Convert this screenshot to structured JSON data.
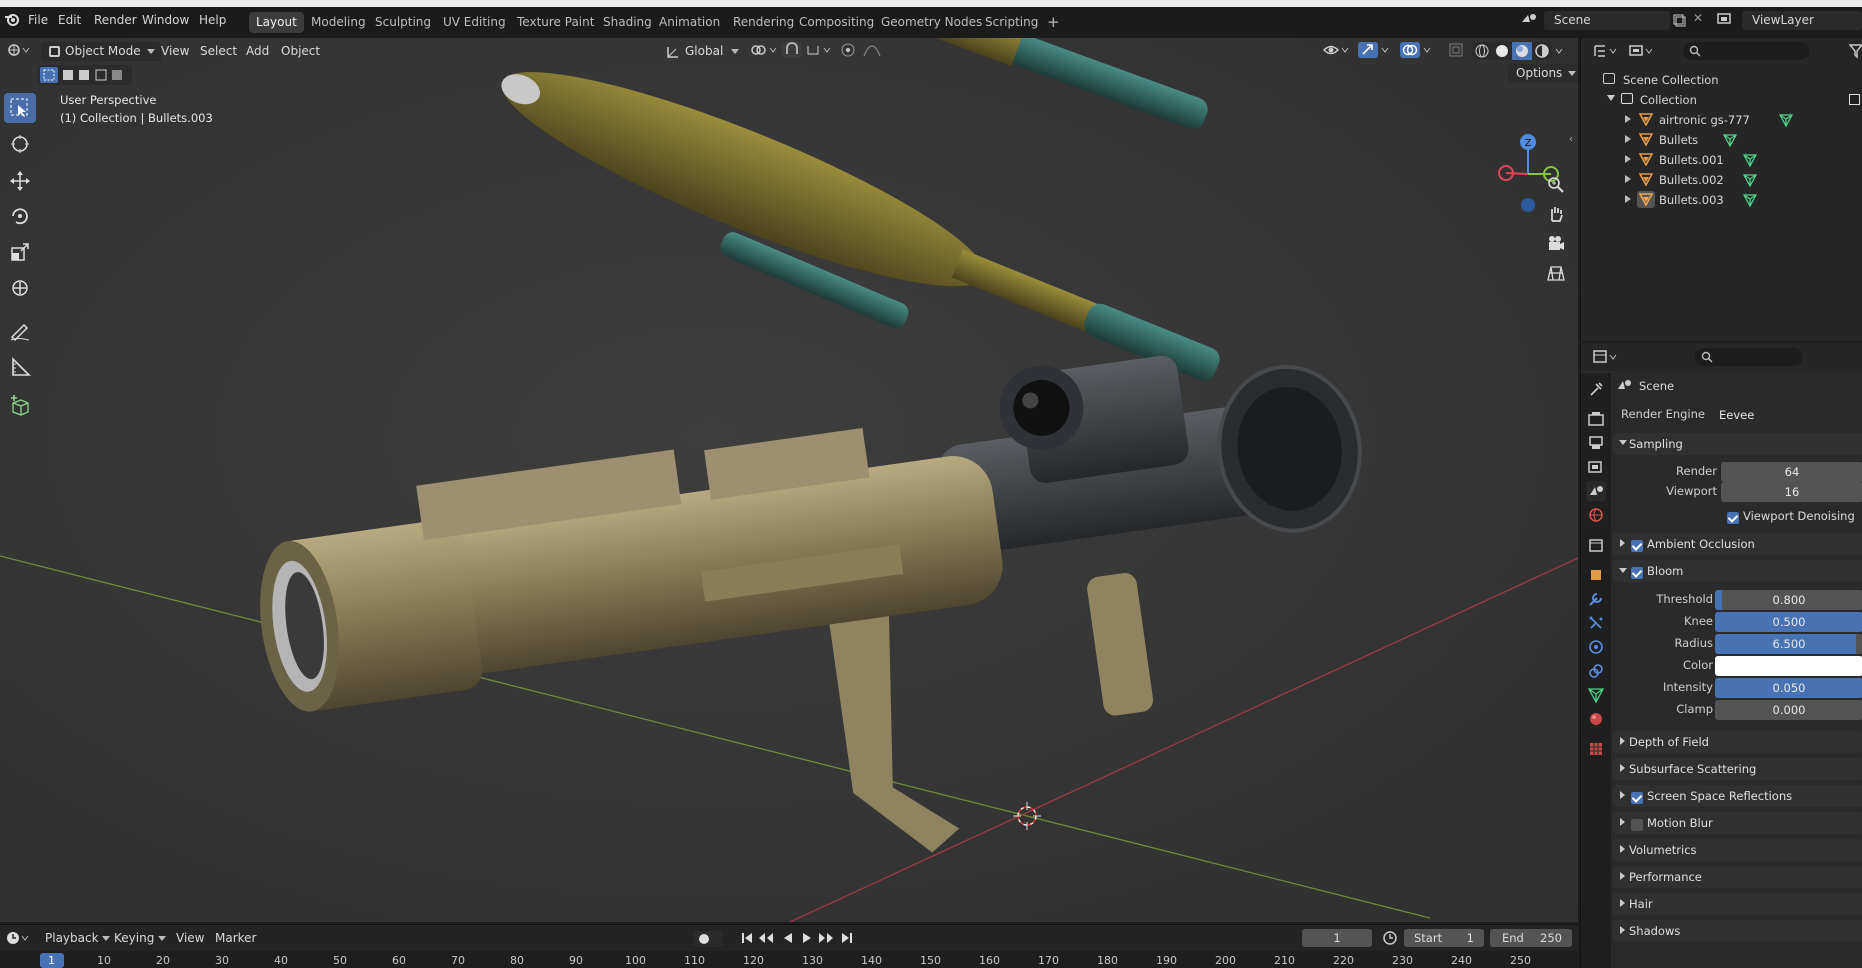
{
  "topbar": {
    "menus": [
      "File",
      "Edit",
      "Render",
      "Window",
      "Help"
    ],
    "workspaces": [
      "Layout",
      "Modeling",
      "Sculpting",
      "UV Editing",
      "Texture Paint",
      "Shading",
      "Animation",
      "Rendering",
      "Compositing",
      "Geometry Nodes",
      "Scripting"
    ],
    "active_workspace": "Layout",
    "add_workspace": "+",
    "scene_label": "Scene",
    "viewlayer_label": "ViewLayer"
  },
  "viewport_header": {
    "mode": "Object Mode",
    "menus": [
      "View",
      "Select",
      "Add",
      "Object"
    ],
    "orientation": "Global",
    "options": "Options"
  },
  "viewport": {
    "perspective": "User Perspective",
    "collection_info": "(1) Collection | Bullets.003",
    "gizmo_axes": [
      "Z",
      "X",
      "Y"
    ],
    "colors": {
      "x": "#e2455a",
      "y": "#8bc34a",
      "z": "#4f8be0",
      "accent": "#4772b3"
    }
  },
  "outliner": {
    "root": "Scene Collection",
    "collection": "Collection",
    "items": [
      "airtronic gs-777",
      "Bullets",
      "Bullets.001",
      "Bullets.002",
      "Bullets.003"
    ]
  },
  "properties": {
    "context": "Scene",
    "render_engine_label": "Render Engine",
    "render_engine": "Eevee",
    "sampling": {
      "title": "Sampling",
      "render_label": "Render",
      "render": "64",
      "viewport_label": "Viewport",
      "viewport": "16",
      "denoise": "Viewport Denoising"
    },
    "ambient_occlusion": "Ambient Occlusion",
    "bloom": {
      "title": "Bloom",
      "threshold_label": "Threshold",
      "threshold": "0.800",
      "threshold_fill": 0.05,
      "knee_label": "Knee",
      "knee": "0.500",
      "knee_fill": 1.0,
      "radius_label": "Radius",
      "radius": "6.500",
      "radius_fill": 0.95,
      "color_label": "Color",
      "intensity_label": "Intensity",
      "intensity": "0.050",
      "intensity_fill": 1.0,
      "clamp_label": "Clamp",
      "clamp": "0.000"
    },
    "panels": [
      {
        "label": "Depth of Field",
        "checkbox": null
      },
      {
        "label": "Subsurface Scattering",
        "checkbox": null
      },
      {
        "label": "Screen Space Reflections",
        "checkbox": true
      },
      {
        "label": "Motion Blur",
        "checkbox": false
      },
      {
        "label": "Volumetrics",
        "checkbox": null
      },
      {
        "label": "Performance",
        "checkbox": null
      },
      {
        "label": "Hair",
        "checkbox": null
      },
      {
        "label": "Shadows",
        "checkbox": null
      }
    ]
  },
  "timeline": {
    "menus": [
      "Playback",
      "Keying",
      "View",
      "Marker"
    ],
    "current_frame": "1",
    "start_label": "Start",
    "start": "1",
    "end_label": "End",
    "end": "250",
    "ruler": [
      "1",
      "10",
      "20",
      "30",
      "40",
      "50",
      "60",
      "70",
      "80",
      "90",
      "100",
      "110",
      "120",
      "130",
      "140",
      "150",
      "160",
      "170",
      "180",
      "190",
      "200",
      "210",
      "220",
      "230",
      "240",
      "250"
    ]
  }
}
